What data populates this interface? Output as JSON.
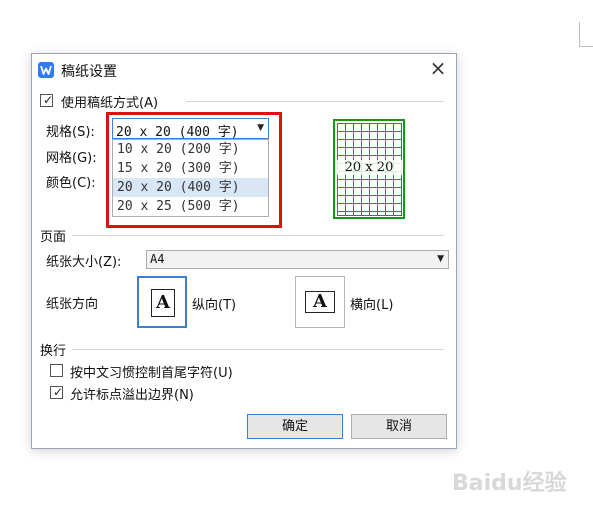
{
  "dialog": {
    "title": "稿纸设置",
    "close_label": "×"
  },
  "use_paper": {
    "label": "使用稿纸方式(A)",
    "checked": true
  },
  "spec": {
    "label": "规格(S):",
    "value": "20 x 20 (400 字)",
    "options": [
      "10 x 20 (200 字)",
      "15 x 20 (300 字)",
      "20 x 20 (400 字)",
      "20 x 25 (500 字)"
    ],
    "selected_index": 2
  },
  "grid": {
    "label": "网格(G):"
  },
  "color": {
    "label": "颜色(C):"
  },
  "preview": {
    "label": "20 x 20",
    "color": "#139a1c"
  },
  "page": {
    "section_label": "页面",
    "paper_size_label": "纸张大小(Z):",
    "paper_size_value": "A4",
    "orientation_label": "纸张方向",
    "portrait_label": "纵向(T)",
    "landscape_label": "横向(L)",
    "page_icon_letter": "A"
  },
  "wrap": {
    "section_label": "换行",
    "option1_label": "按中文习惯控制首尾字符(U)",
    "option1_checked": false,
    "option2_label": "允许标点溢出边界(N)",
    "option2_checked": true
  },
  "buttons": {
    "ok": "确定",
    "cancel": "取消"
  },
  "watermark": {
    "text": "Baidu经验"
  },
  "colors": {
    "accent": "#3c7fd6",
    "highlight": "#e01010"
  }
}
